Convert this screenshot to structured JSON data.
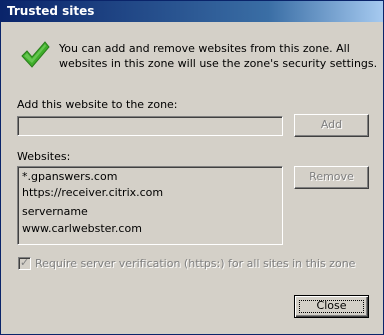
{
  "dialog": {
    "title": "Trusted sites",
    "close_glyph": "×",
    "icon": "checkmark-icon",
    "intro_text": "You can add and remove websites from this zone. All websites in this zone will use the zone's security settings."
  },
  "add_section": {
    "label": "Add this website to the zone:",
    "input_value": "",
    "add_button": "Add"
  },
  "websites_section": {
    "label": "Websites:",
    "sites": [
      "*.gpanswers.com",
      "https://receiver.citrix.com",
      "servername",
      "www.carlwebster.com"
    ],
    "remove_button": "Remove"
  },
  "verification": {
    "label": "Require server verification (https:) for all sites in this zone",
    "checked": true,
    "enabled": false
  },
  "footer": {
    "close_button": "Close"
  },
  "colors": {
    "titlebar_start": "#0a246a",
    "titlebar_end": "#a6caf0",
    "dialog_bg": "#d4d0c8",
    "checkmark_green": "#3fae2a"
  }
}
